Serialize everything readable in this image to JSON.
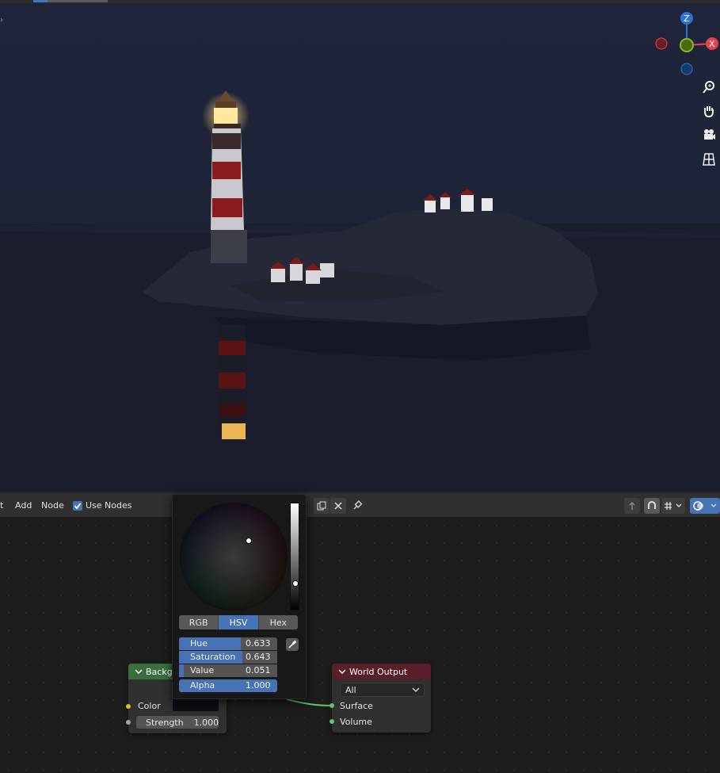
{
  "node_editor": {
    "menu": {
      "partial": "t",
      "add": "Add",
      "node": "Node"
    },
    "use_nodes_label": "Use Nodes",
    "use_nodes_checked": true
  },
  "background_node": {
    "title": "Backgro",
    "color_label": "Color",
    "strength_label": "Strength",
    "strength_value": "1.000",
    "header_color": "#3a6e3f"
  },
  "world_output_node": {
    "title": "World Output",
    "target_select": "All",
    "surface_label": "Surface",
    "volume_label": "Volume",
    "header_color": "#5a1e2a"
  },
  "color_picker": {
    "modes": [
      "RGB",
      "HSV",
      "Hex"
    ],
    "active_mode": "HSV",
    "fields": [
      {
        "label": "Hue",
        "value": "0.633",
        "fraction": 0.633
      },
      {
        "label": "Saturation",
        "value": "0.643",
        "fraction": 0.643
      },
      {
        "label": "Value",
        "value": "0.051",
        "fraction": 0.051
      },
      {
        "label": "Alpha",
        "value": "1.000",
        "fraction": 1.0
      }
    ],
    "accent": "#4772b3"
  },
  "viewport": {
    "gizmo_axes": {
      "z": "Z",
      "x": "X"
    },
    "axis_colors": {
      "x": "#e0424f",
      "y": "#87b92a",
      "z": "#2d74d2"
    }
  }
}
